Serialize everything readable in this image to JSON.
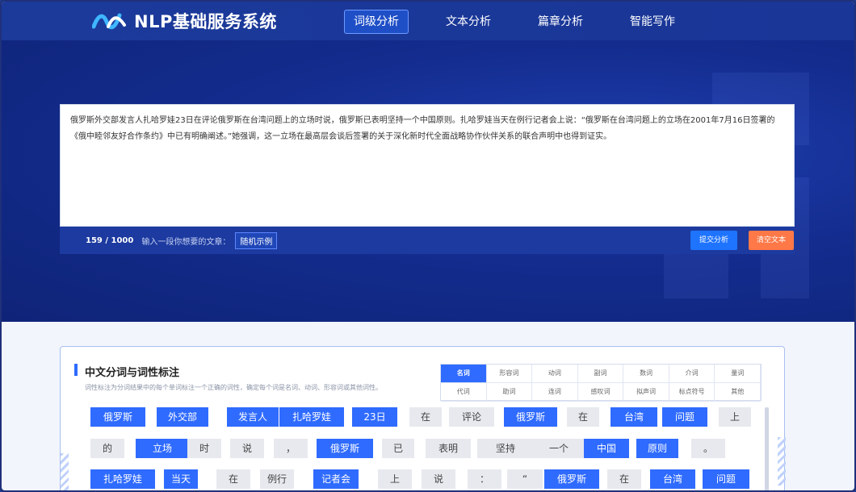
{
  "app": {
    "title": "NLP基础服务系统"
  },
  "nav": {
    "items": [
      {
        "label": "词级分析",
        "active": true
      },
      {
        "label": "文本分析",
        "active": false
      },
      {
        "label": "篇章分析",
        "active": false
      },
      {
        "label": "智能写作",
        "active": false
      }
    ]
  },
  "editor": {
    "text": "俄罗斯外交部发言人扎哈罗娃23日在评论俄罗斯在台湾问题上的立场时说，俄罗斯已表明坚持一个中国原则。扎哈罗娃当天在例行记者会上说：“俄罗斯在台湾问题上的立场在2001年7月16日签署的《俄中睦邻友好合作条约》中已有明确阐述。”她强调，这一立场在最高层会谈后签署的关于深化新时代全面战略协作伙伴关系的联合声明中也得到证实。",
    "count": "159 / 1000",
    "hint": "输入一段你想要的文章：",
    "random_label": "随机示例",
    "submit_label": "提交分析",
    "clear_label": "清空文本"
  },
  "section": {
    "title": "中文分词与词性标注",
    "desc": "词性标注为分词结果中的每个单词标注一个正确的词性，确定每个词是名词、动词、形容词或其他词性。"
  },
  "pos_tags": [
    "名词",
    "形容词",
    "动词",
    "副词",
    "数词",
    "介词",
    "量词",
    "代词",
    "助词",
    "连词",
    "感叹词",
    "拟声词",
    "标点符号",
    "其他"
  ],
  "colors": {
    "noun": "#2f6bff",
    "other": "#e7e9ee",
    "accent": "#1f74ff",
    "danger": "#ff7847"
  },
  "tokens": [
    {
      "text": "俄罗斯",
      "type": "noun"
    },
    {
      "text": "外交部",
      "type": "noun"
    },
    {
      "text": "发言人",
      "type": "noun"
    },
    {
      "text": "扎哈罗娃",
      "type": "noun"
    },
    {
      "text": "23日",
      "type": "noun"
    },
    {
      "text": "在",
      "type": "other"
    },
    {
      "text": "评论",
      "type": "other"
    },
    {
      "text": "俄罗斯",
      "type": "noun"
    },
    {
      "text": "在",
      "type": "other"
    },
    {
      "text": "台湾",
      "type": "noun"
    },
    {
      "text": "问题",
      "type": "noun"
    },
    {
      "text": "上",
      "type": "other"
    },
    {
      "text": "的",
      "type": "other"
    },
    {
      "text": "立场",
      "type": "noun"
    },
    {
      "text": "时",
      "type": "other"
    },
    {
      "text": "说",
      "type": "other"
    },
    {
      "text": "，",
      "type": "other"
    },
    {
      "text": "俄罗斯",
      "type": "noun"
    },
    {
      "text": "已",
      "type": "other"
    },
    {
      "text": "表明",
      "type": "other"
    },
    {
      "text": "坚持",
      "type": "other"
    },
    {
      "text": "一个",
      "type": "other"
    },
    {
      "text": "中国",
      "type": "noun"
    },
    {
      "text": "原则",
      "type": "noun"
    },
    {
      "text": "。",
      "type": "other"
    },
    {
      "text": "扎哈罗娃",
      "type": "noun"
    },
    {
      "text": "当天",
      "type": "noun"
    },
    {
      "text": "在",
      "type": "other"
    },
    {
      "text": "例行",
      "type": "other"
    },
    {
      "text": "记者会",
      "type": "noun"
    },
    {
      "text": "上",
      "type": "other"
    },
    {
      "text": "说",
      "type": "other"
    },
    {
      "text": "：",
      "type": "other"
    },
    {
      "text": "“",
      "type": "other"
    },
    {
      "text": "俄罗斯",
      "type": "noun"
    },
    {
      "text": "在",
      "type": "other"
    },
    {
      "text": "台湾",
      "type": "noun"
    },
    {
      "text": "问题",
      "type": "noun"
    }
  ]
}
